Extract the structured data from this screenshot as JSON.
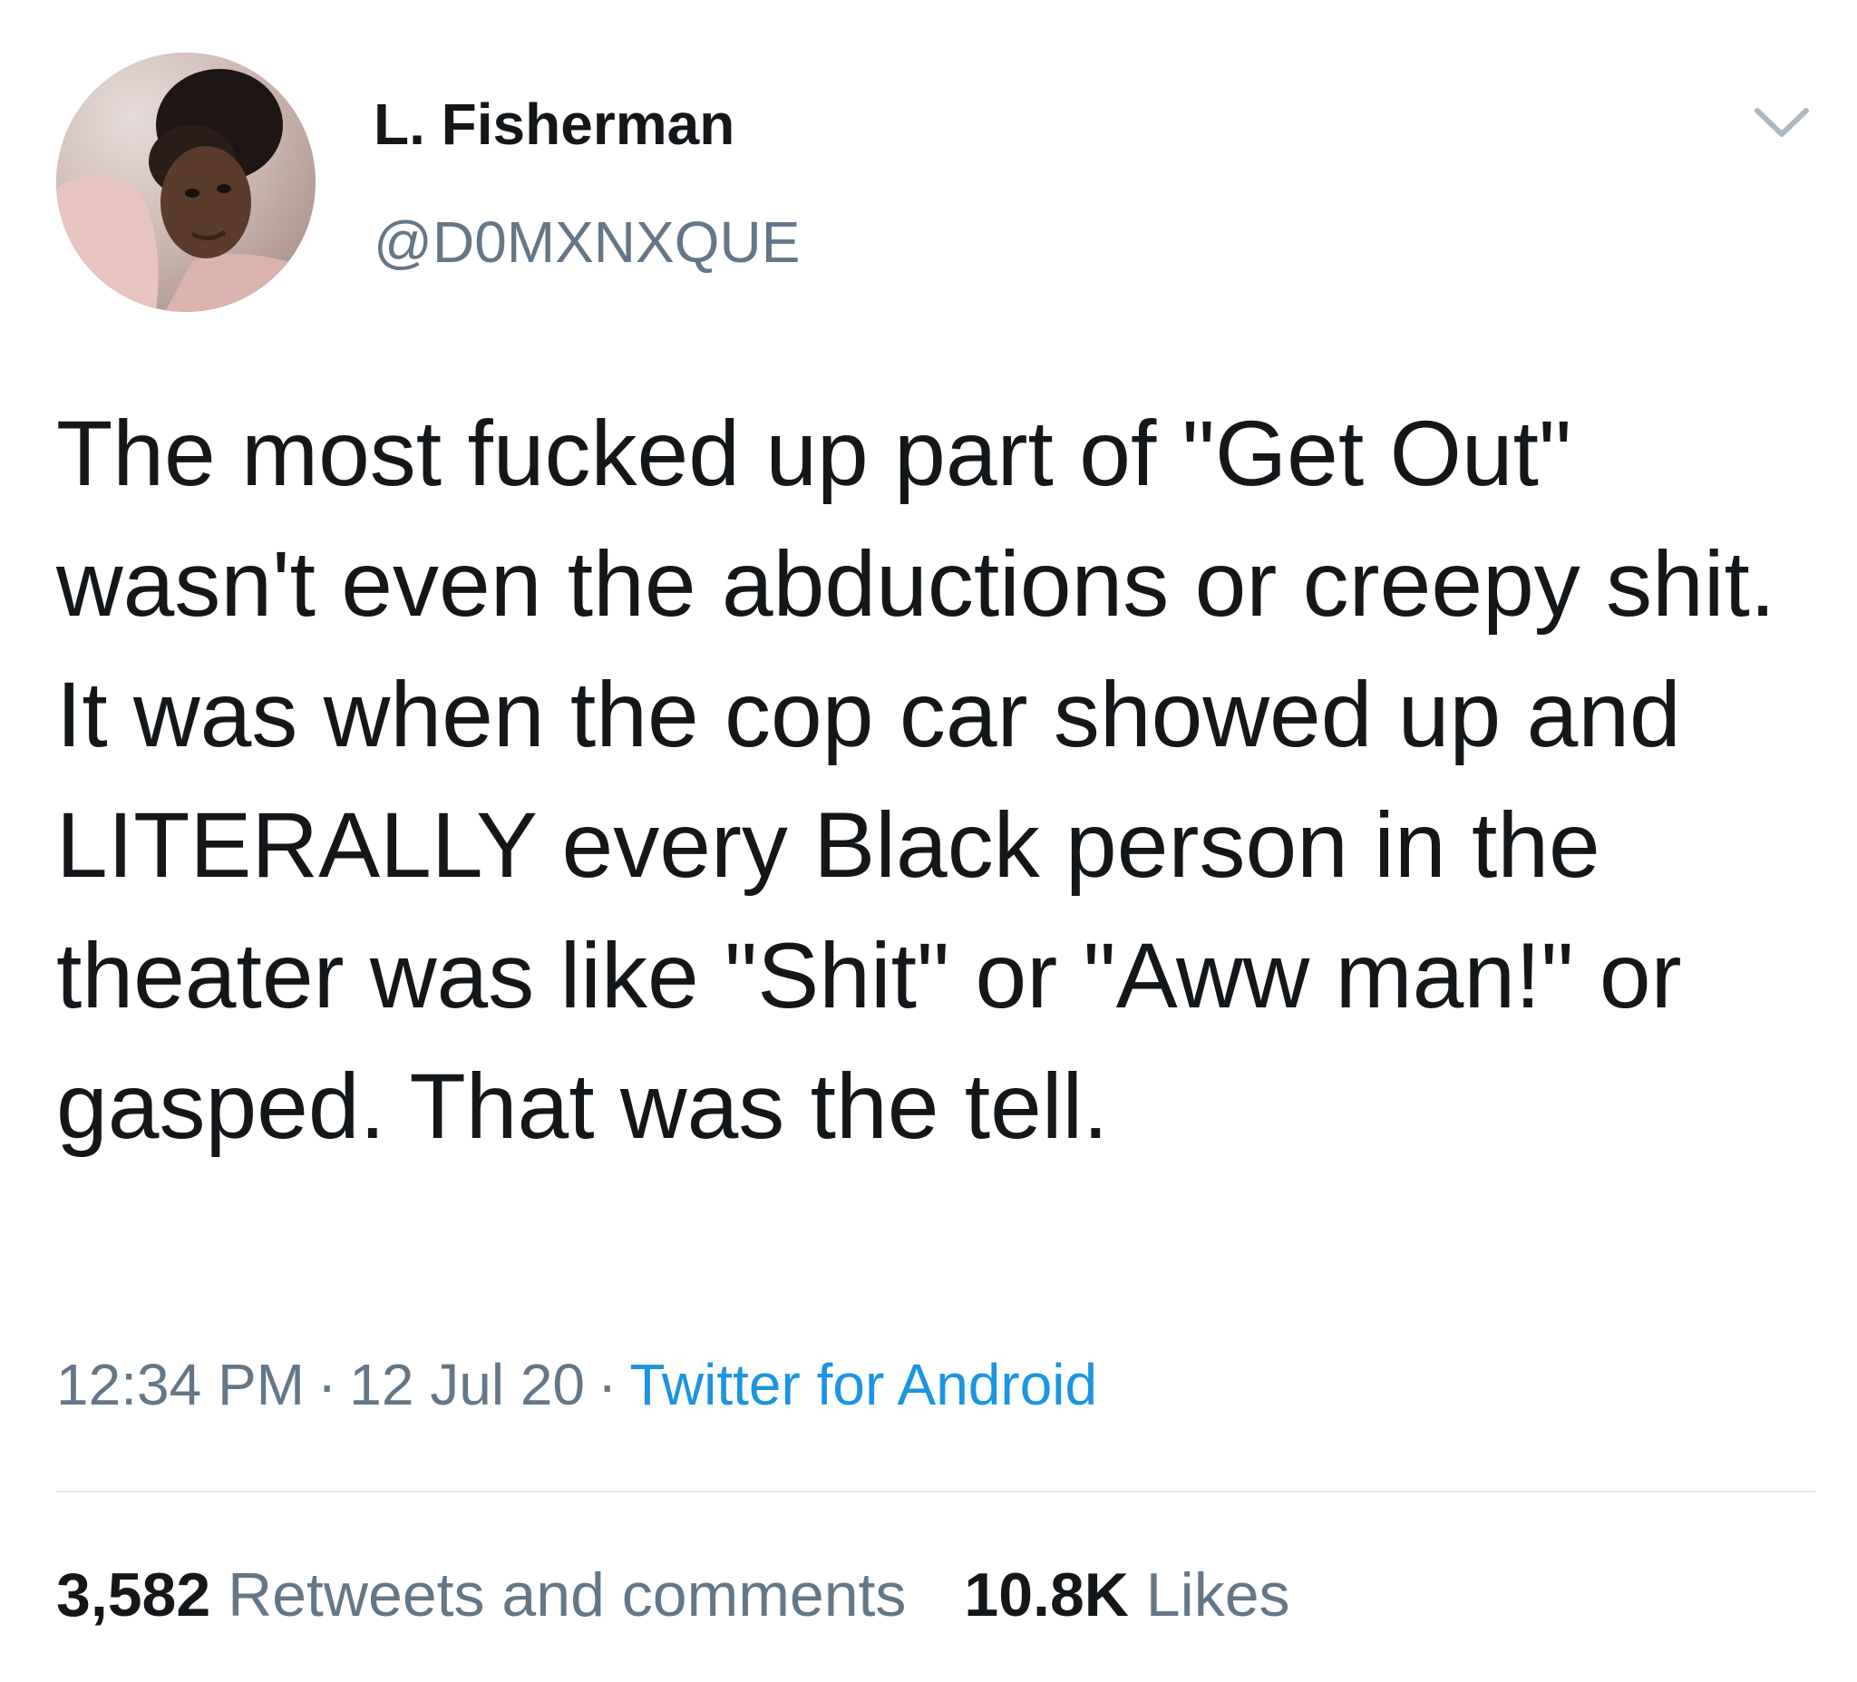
{
  "user": {
    "display_name": "L. Fisherman",
    "handle": "@D0MXNXQUE",
    "avatar_icon": "profile-photo"
  },
  "menu": {
    "icon": "chevron-down-icon"
  },
  "tweet": {
    "text": "The most fucked up part of \"Get Out\" wasn't even the abductions or creepy shit. It was when the cop car showed up and LITERALLY every Black person in the theater was like \"Shit\" or \"Aww man!\" or gasped. That was the tell."
  },
  "meta": {
    "time": "12:34 PM",
    "separator": "·",
    "date": "12 Jul 20",
    "source": "Twitter for Android"
  },
  "stats": {
    "retweets_count": "3,582",
    "retweets_label": "Retweets and comments",
    "likes_count": "10.8K",
    "likes_label": "Likes"
  },
  "colors": {
    "text": "#14171a",
    "secondary": "#657786",
    "link": "#1b95e0",
    "divider": "#e1e8ed"
  }
}
